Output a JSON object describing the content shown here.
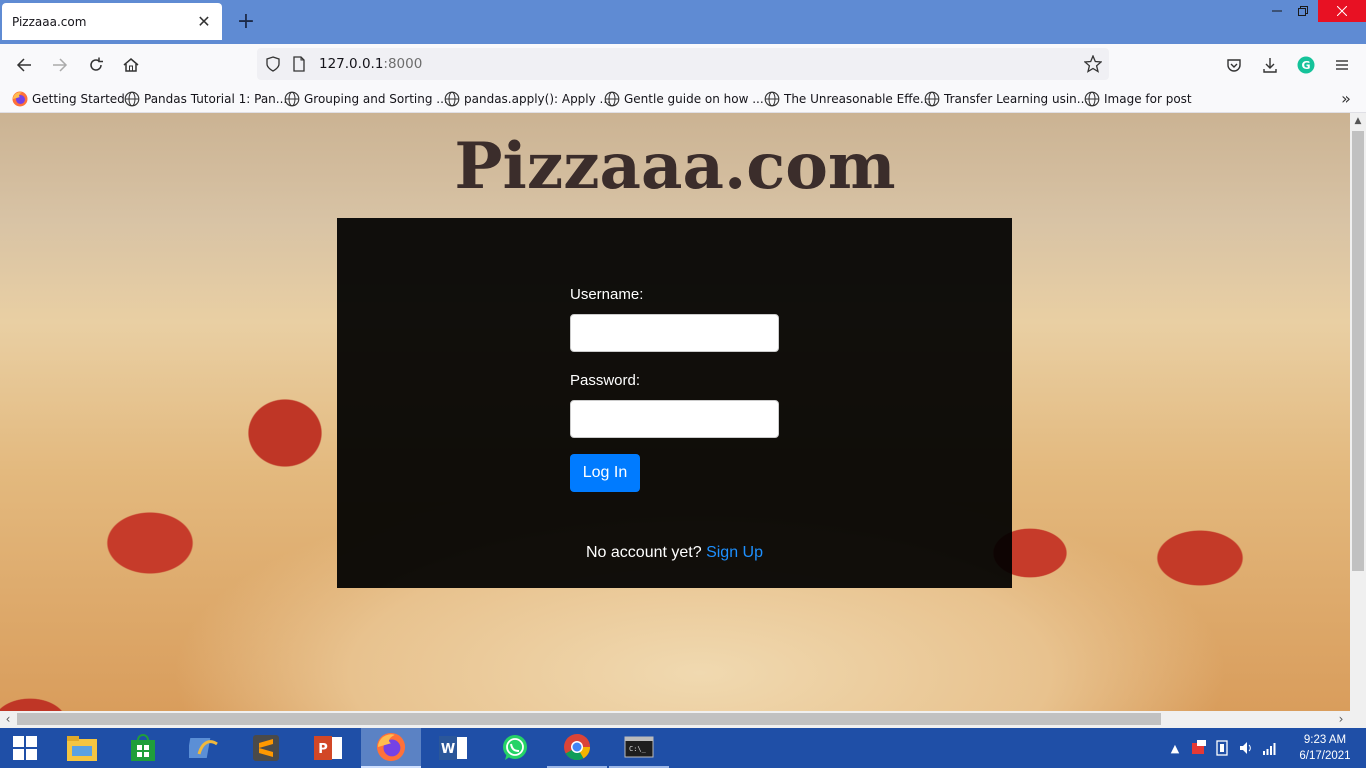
{
  "browser": {
    "tab_title": "Pizzaaa.com",
    "tab_close_glyph": "✕",
    "new_tab_glyph": "+",
    "url_host": "127.0.0.1",
    "url_port": ":8000"
  },
  "bookmarks": [
    {
      "label": "Getting Started",
      "icon": "firefox-icon"
    },
    {
      "label": "Pandas Tutorial 1: Pan...",
      "icon": "globe-icon"
    },
    {
      "label": "Grouping and Sorting ...",
      "icon": "globe-icon"
    },
    {
      "label": "pandas.apply(): Apply ...",
      "icon": "globe-icon"
    },
    {
      "label": "Gentle guide on how ...",
      "icon": "globe-icon"
    },
    {
      "label": "The Unreasonable Effe...",
      "icon": "globe-icon"
    },
    {
      "label": "Transfer Learning usin...",
      "icon": "globe-icon"
    },
    {
      "label": "Image for post",
      "icon": "globe-icon"
    }
  ],
  "page": {
    "title": "Pizzaaa.com",
    "username_label": "Username:",
    "password_label": "Password:",
    "username_value": "",
    "password_value": "",
    "login_button": "Log In",
    "no_account_text": "No account yet?",
    "signup_link": "Sign Up"
  },
  "taskbar": {
    "time": "9:23 AM",
    "date": "6/17/2021",
    "apps": [
      "start",
      "file-explorer",
      "store",
      "app-4",
      "sublime-text",
      "powerpoint",
      "firefox",
      "word",
      "whatsapp",
      "chrome",
      "terminal"
    ]
  },
  "colors": {
    "accent": "#007bff",
    "titlebar": "#5f8bd3",
    "taskbar": "#1f4fa7"
  }
}
